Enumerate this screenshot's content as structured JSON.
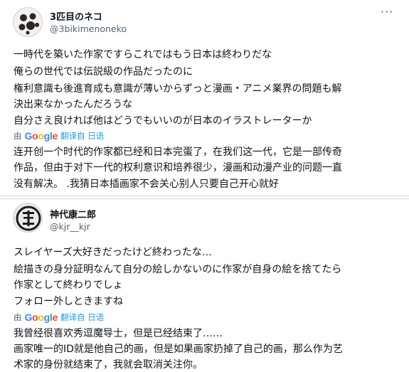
{
  "tweets": [
    {
      "author_name": "3匹目のネコ",
      "author_handle": "@3bikimenoneko",
      "original_lines": [
        "一時代を築いた作家ですらこれではもう日本は終わりだな",
        "俺らの世代では伝説級の作品だったのに",
        "権利意識も後進育成も意識が薄いからずっと漫画・アニメ業界の問題も解",
        "決出来なかったんだろうな",
        "自分さえ良ければ他はどうでもいいのが日本のイラストレーターか"
      ],
      "translation_by": "由",
      "translation_provider": "Google",
      "translated_from": "翻译自 日语",
      "translated_lines": [
        "连开创一个时代的作家都已经和日本完蛋了，在我们这一代，它是一部传奇",
        "作品，但由于对下一代的权利意识和培养很少，漫画和动漫产业的问题一直",
        "没有解决。 .我猜日本插画家不会关心别人只要自己开心就好"
      ]
    },
    {
      "author_name": "神代康二郎",
      "author_handle": "@kjr__kjr",
      "original_lines": [
        "スレイヤーズ大好きだったけど終わったな…",
        "絵描きの身分証明なんて自分の絵しかないのに作家が自身の絵を捨てたら",
        "作家として終わりでしょ",
        "フォロー外しときますね"
      ],
      "translation_by": "由",
      "translation_provider": "Google",
      "translated_from": "翻译自 日语",
      "translated_lines": [
        "我曾经很喜欢秀逗魔导士，但是已经结束了……",
        "画家唯一的ID就是他自己的画，但是如果画家扔掉了自己的画，那么作为艺",
        "术家的身份就结束了，我就会取消关注你。"
      ]
    }
  ],
  "icons": {
    "avatar1": "cat-paw-spots-avatar",
    "avatar2": "dark-emblem-avatar",
    "more": "more-options-icon"
  },
  "colors": {
    "text": "#0f1419",
    "muted": "#536471",
    "link": "#1d9bf0",
    "divider": "#dcdcdc",
    "google_blue": "#4285F4",
    "google_red": "#EA4335",
    "google_yellow": "#FBBC05",
    "google_green": "#34A853"
  }
}
